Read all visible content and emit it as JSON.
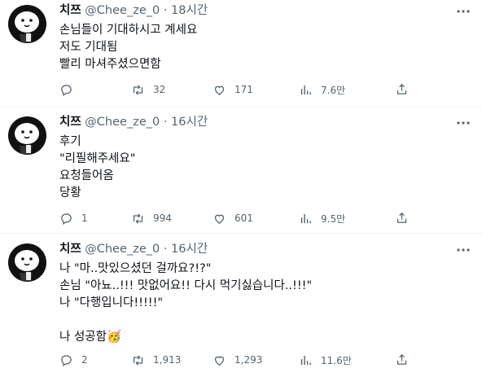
{
  "tweets": [
    {
      "name": "치쯔",
      "handle": "@Chee_ze_0",
      "dot": "·",
      "time": "18시간",
      "lines": [
        "손님들이 기대하시고 계세요",
        "저도 기대됨",
        "빨리 마셔주셨으면함"
      ],
      "replies": "",
      "retweets": "32",
      "likes": "171",
      "views": "7.6만"
    },
    {
      "name": "치쯔",
      "handle": "@Chee_ze_0",
      "dot": "·",
      "time": "16시간",
      "lines": [
        "후기",
        "\"리필해주세요\"",
        "요청들어옴",
        "당황"
      ],
      "replies": "1",
      "retweets": "994",
      "likes": "601",
      "views": "9.5만"
    },
    {
      "name": "치쯔",
      "handle": "@Chee_ze_0",
      "dot": "·",
      "time": "16시간",
      "lines": [
        "나 \"마..맛있으셨던 걸까요?!?\"",
        "손님 \"아뇨..!!! 맛없어요!! 다시 먹기싫습니다..!!!\"",
        "나 \"다행입니다!!!!!\"",
        "",
        "나 성공함🥳"
      ],
      "replies": "2",
      "retweets": "1,913",
      "likes": "1,293",
      "views": "11.6만"
    }
  ],
  "icons": {
    "more": "more-icon",
    "reply": "reply-icon",
    "retweet": "retweet-icon",
    "like": "heart-icon",
    "views": "views-icon",
    "share": "share-icon"
  }
}
